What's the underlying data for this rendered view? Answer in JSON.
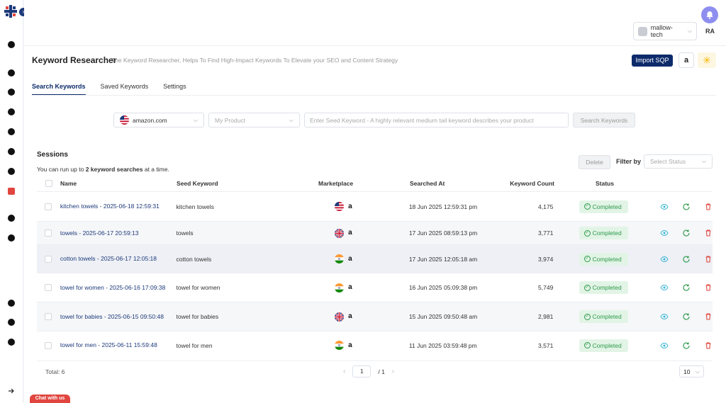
{
  "sidebar": {
    "icons": [
      "dashboard-icon",
      "cart-icon",
      "dollar-icon",
      "settings-gear-icon",
      "megaphone-icon",
      "target-icon",
      "shield-icon",
      "keyword-icon",
      "boxes-icon",
      "bag-icon",
      "telegram-icon",
      "bell-icon",
      "gear-icon",
      "expand-arrow-icon"
    ]
  },
  "topbar": {
    "user": "mallow-tech",
    "initials": "RA"
  },
  "page": {
    "title": "Keyword Researcher",
    "subtitle": "The Keyword Researcher, Helps To Find High-Impact Keywords To Elevate your SEO and Content Strategy",
    "import_label": "Import SQP",
    "amazon_glyph": "a",
    "walmart_glyph": "✳"
  },
  "tabs": [
    "Search Keywords",
    "Saved Keywords",
    "Settings"
  ],
  "search": {
    "marketplace": "amazon.com",
    "product_placeholder": "My Product",
    "seed_placeholder": "Enter Seed Keyword - A highly relevant medium tail keyword describes your product",
    "search_label": "Search Keywords"
  },
  "sessions": {
    "title": "Sessions",
    "note_pre": "You can run up to ",
    "note_bold": "2 keyword searches",
    "note_post": " at a time.",
    "delete_label": "Delete",
    "filter_label": "Filter by",
    "status_placeholder": "Select Status"
  },
  "table": {
    "headers": [
      "Name",
      "Seed Keyword",
      "Marketplace",
      "Searched At",
      "Keyword Count",
      "Status"
    ],
    "rows": [
      {
        "name": "kitchen towels - 2025-06-18 12:59:31",
        "seed": "kitchen towels",
        "flag": "us",
        "date": "18 Jun 2025 12:59:31 pm",
        "count": "4,175",
        "status": "Completed"
      },
      {
        "name": "towels - 2025-06-17 20:59:13",
        "seed": "towels",
        "flag": "uk",
        "date": "17 Jun 2025 08:59:13 pm",
        "count": "3,771",
        "status": "Completed"
      },
      {
        "name": "cotton towels - 2025-06-17 12:05:18",
        "seed": "cotton towels",
        "flag": "in",
        "date": "17 Jun 2025 12:05:18 am",
        "count": "3,974",
        "status": "Completed"
      },
      {
        "name": "towel for women - 2025-06-16 17:09:38",
        "seed": "towel for women",
        "flag": "in",
        "date": "16 Jun 2025 05:09:38 pm",
        "count": "5,749",
        "status": "Completed"
      },
      {
        "name": "towel for babies - 2025-06-15 09:50:48",
        "seed": "towel for babies",
        "flag": "uk",
        "date": "15 Jun 2025 09:50:48 am",
        "count": "2,981",
        "status": "Completed"
      },
      {
        "name": "towel for men - 2025-06-11 15:59:48",
        "seed": "towel for men",
        "flag": "in",
        "date": "11 Jun 2025 03:59:48 pm",
        "count": "3,571",
        "status": "Completed"
      }
    ],
    "total": "Total: 6",
    "page": "1",
    "of_pages": "/ 1",
    "per_page": "10"
  },
  "chat": {
    "label": "Chat with us"
  },
  "colors": {
    "accent": "#0d2b6b",
    "success": "#2e9a4c",
    "danger": "#e0463f",
    "view": "#3bb6d6"
  }
}
